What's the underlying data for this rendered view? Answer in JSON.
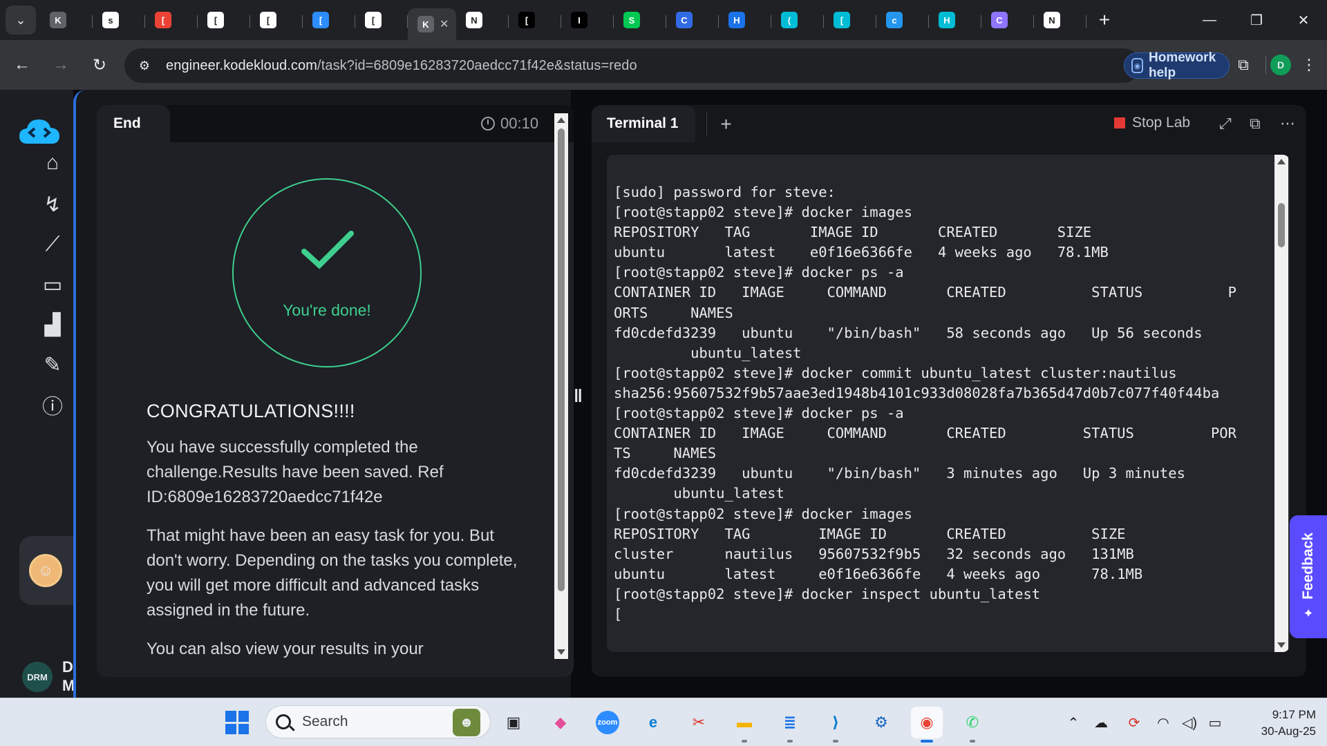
{
  "browser": {
    "tabs": [
      {
        "letter": "K",
        "color": "#5f6368",
        "icon": "kodekloud-favicon"
      },
      {
        "letter": "s",
        "color": "#ffffff",
        "icon": "google-favicon"
      },
      {
        "letter": "[",
        "color": "#ea4335",
        "icon": "gmail-favicon"
      },
      {
        "letter": "[",
        "color": "#ffffff",
        "icon": "github-favicon"
      },
      {
        "letter": "[",
        "color": "#ffffff",
        "icon": "github-favicon"
      },
      {
        "letter": "[",
        "color": "#2d8cff",
        "icon": "zoom-favicon"
      },
      {
        "letter": "[",
        "color": "#ffffff",
        "icon": "github-favicon"
      },
      {
        "letter": "K",
        "color": "#5f6368",
        "icon": "kodekloud-favicon",
        "active": true
      },
      {
        "letter": "N",
        "color": "#ffffff",
        "icon": "notion-favicon"
      },
      {
        "letter": "[",
        "color": "#000000",
        "icon": "medium-favicon"
      },
      {
        "letter": "I",
        "color": "#000000",
        "icon": "medium-favicon"
      },
      {
        "letter": "S",
        "color": "#00c853",
        "icon": "site-favicon"
      },
      {
        "letter": "C",
        "color": "#326ce5",
        "icon": "kubernetes-favicon"
      },
      {
        "letter": "H",
        "color": "#1a73e8",
        "icon": "site-favicon"
      },
      {
        "letter": "(",
        "color": "#00bcd4",
        "icon": "eye-favicon"
      },
      {
        "letter": "[",
        "color": "#00bcd4",
        "icon": "eye-favicon"
      },
      {
        "letter": "c",
        "color": "#2496ed",
        "icon": "docker-favicon"
      },
      {
        "letter": "H",
        "color": "#00bcd4",
        "icon": "eye-favicon"
      },
      {
        "letter": "C",
        "color": "#8e75ff",
        "icon": "gemini-favicon"
      },
      {
        "letter": "N",
        "color": "#ffffff",
        "icon": "chatgpt-favicon"
      }
    ],
    "active_tab_letter": "K",
    "url_host": "engineer.kodekloud.com",
    "url_path": "/task?id=6809e16283720aedcc71f42e&status=redo",
    "homework_help": "Homework help",
    "profile_initial": "D"
  },
  "sidebar": {
    "user_initials": "DRM",
    "user_name_line1": "D",
    "user_name_line2": "M"
  },
  "left_panel": {
    "tab_label": "End",
    "timer": "00:10",
    "done_text": "You're done!",
    "heading": "CONGRATULATIONS!!!!",
    "paragraph1": "You have successfully completed the challenge.Results have been saved. Ref ID:6809e16283720aedcc71f42e",
    "paragraph2": "That might have been an easy task for you. But don't worry. Depending on the tasks you complete, you will get more difficult and advanced tasks assigned in the future.",
    "paragraph3": "You can also view your results in your"
  },
  "right_panel": {
    "tab_label": "Terminal 1",
    "stop_lab": "Stop Lab",
    "feedback": "Feedback",
    "terminal_lines": [
      "[sudo] password for steve:",
      "[root@stapp02 steve]# docker images",
      "REPOSITORY   TAG       IMAGE ID       CREATED       SIZE",
      "ubuntu       latest    e0f16e6366fe   4 weeks ago   78.1MB",
      "[root@stapp02 steve]# docker ps -a",
      "CONTAINER ID   IMAGE     COMMAND       CREATED          STATUS          P",
      "ORTS     NAMES",
      "fd0cdefd3239   ubuntu    \"/bin/bash\"   58 seconds ago   Up 56 seconds",
      "         ubuntu_latest",
      "[root@stapp02 steve]# docker commit ubuntu_latest cluster:nautilus",
      "sha256:95607532f9b57aae3ed1948b4101c933d08028fa7b365d47d0b7c077f40f44ba",
      "[root@stapp02 steve]# docker ps -a",
      "CONTAINER ID   IMAGE     COMMAND       CREATED         STATUS         POR",
      "TS     NAMES",
      "fd0cdefd3239   ubuntu    \"/bin/bash\"   3 minutes ago   Up 3 minutes",
      "       ubuntu_latest",
      "[root@stapp02 steve]# docker images",
      "REPOSITORY   TAG        IMAGE ID       CREATED          SIZE",
      "cluster      nautilus   95607532f9b5   32 seconds ago   131MB",
      "ubuntu       latest     e0f16e6366fe   4 weeks ago      78.1MB",
      "[root@stapp02 steve]# docker inspect ubuntu_latest",
      "["
    ]
  },
  "taskbar": {
    "search_placeholder": "Search",
    "apps": [
      {
        "name": "taskview-app",
        "glyph": "▣",
        "color": "#202124"
      },
      {
        "name": "copilot-app",
        "glyph": "◆",
        "color": "#e44f9a"
      },
      {
        "name": "zoom-app",
        "glyph": "zoom",
        "color": "#2d8cff"
      },
      {
        "name": "edge-app",
        "glyph": "e",
        "color": "#0c7fd6"
      },
      {
        "name": "snipping-app",
        "glyph": "✂",
        "color": "#d93025"
      },
      {
        "name": "file-explorer-app",
        "glyph": "▬",
        "color": "#f4b400"
      },
      {
        "name": "notepad-app",
        "glyph": "≣",
        "color": "#1a73e8"
      },
      {
        "name": "vscode-app",
        "glyph": "⟩",
        "color": "#007acc"
      },
      {
        "name": "network-app",
        "glyph": "⚙",
        "color": "#1565c0"
      },
      {
        "name": "chrome-app",
        "glyph": "◉",
        "color": "#ea4335",
        "active": true
      },
      {
        "name": "whatsapp-app",
        "glyph": "✆",
        "color": "#25d366"
      }
    ],
    "time": "9:17 PM",
    "date": "30-Aug-25"
  }
}
